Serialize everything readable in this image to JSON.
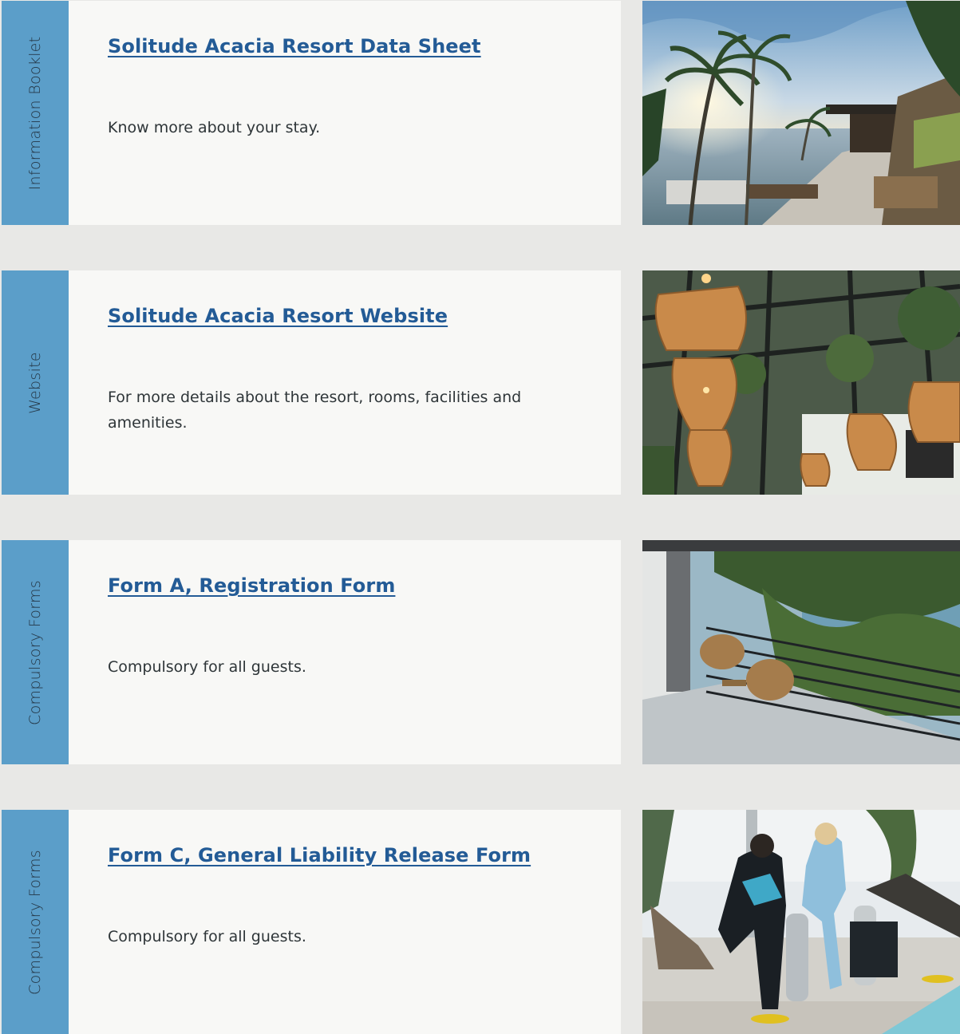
{
  "rows": [
    {
      "tag": "Information Booklet",
      "title": "Solitude Acacia Resort Data Sheet",
      "description": "Know more about your stay.",
      "image": "resort-sunset-terrace-photo"
    },
    {
      "tag": "Website",
      "title": "Solitude Acacia Resort Website",
      "description": "For more details about the resort, rooms, facilities and amenities.",
      "image": "rattan-pendant-lamps-photo"
    },
    {
      "tag": "Compulsory Forms",
      "title": "Form A, Registration Form",
      "description": "Compulsory for all guests.",
      "image": "balcony-ocean-view-photo"
    },
    {
      "tag": "Compulsory Forms",
      "title": "Form C, General Liability Release Form",
      "description": "Compulsory for all guests.",
      "image": "dive-gear-preparation-photo"
    }
  ],
  "colors": {
    "page_background": "#e8e8e6",
    "tag_background": "#5b9ec9",
    "card_background": "#f8f8f6",
    "link": "#235b96",
    "text": "#2e3538"
  }
}
